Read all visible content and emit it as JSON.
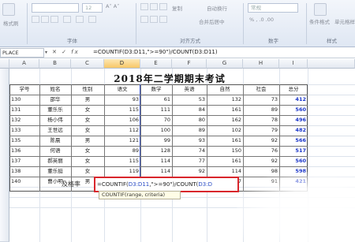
{
  "ribbon": {
    "format_painter": "格式刷",
    "font_size": "12",
    "copy_label": "复制",
    "wrap_text": "自动换行",
    "number_format": "常规",
    "cond_format": "条件格式",
    "cell_style": "单元格样式",
    "merge_center": "合并后居中",
    "group_font": "字体",
    "group_align": "对齐方式",
    "group_number": "数字",
    "group_style": "样式"
  },
  "formula_bar": {
    "name_box": "PLACE",
    "cancel": "✕",
    "enter": "✓",
    "fx": "fx",
    "formula": "=COUNTIF(D3:D11,\">=90\")/COUNT(D3:D11)"
  },
  "columns": [
    "A",
    "B",
    "C",
    "D",
    "E",
    "F",
    "G",
    "H",
    "I"
  ],
  "sheet": {
    "title": "2018年二学期期末考试",
    "headers": [
      "学号",
      "姓名",
      "性别",
      "语文",
      "数学",
      "英语",
      "自然",
      "社会",
      "总分"
    ],
    "rows": [
      [
        "130",
        "邵华",
        "男",
        "93",
        "61",
        "53",
        "132",
        "73",
        "412"
      ],
      [
        "131",
        "董乐乐",
        "女",
        "115",
        "111",
        "84",
        "161",
        "89",
        "560"
      ],
      [
        "132",
        "杨小伟",
        "女",
        "106",
        "70",
        "80",
        "162",
        "78",
        "496"
      ],
      [
        "133",
        "王世远",
        "女",
        "112",
        "100",
        "89",
        "102",
        "79",
        "482"
      ],
      [
        "135",
        "陈晨",
        "男",
        "121",
        "99",
        "93",
        "161",
        "92",
        "566"
      ],
      [
        "136",
        "何语",
        "女",
        "89",
        "128",
        "74",
        "150",
        "76",
        "517"
      ],
      [
        "137",
        "郝英丽",
        "女",
        "115",
        "114",
        "77",
        "161",
        "92",
        "560"
      ],
      [
        "138",
        "董乐挺",
        "女",
        "119",
        "114",
        "92",
        "114",
        "98",
        "598"
      ],
      [
        "140",
        "曹小明",
        "男",
        "108",
        "124",
        "90",
        "47",
        "91",
        "421"
      ]
    ]
  },
  "pass_rate": {
    "label": "及格率",
    "formula_black1": "=COUNTIF(",
    "formula_blue1": "D3:D11",
    "formula_black2": ",\">=90\")/COUNT(",
    "formula_blue2": "D3:D",
    "tooltip": "COUNTIF(range, criteria)"
  }
}
